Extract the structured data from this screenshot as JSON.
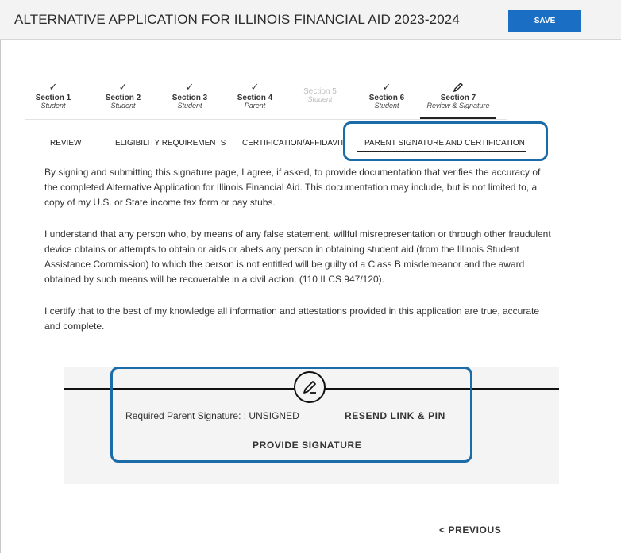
{
  "header": {
    "title": "ALTERNATIVE APPLICATION FOR ILLINOIS FINANCIAL AID 2023-2024",
    "save_label": "SAVE"
  },
  "steps": [
    {
      "name": "Section 1",
      "sub": "Student",
      "check": "✓",
      "state": "complete"
    },
    {
      "name": "Section 2",
      "sub": "Student",
      "check": "✓",
      "state": "complete"
    },
    {
      "name": "Section 3",
      "sub": "Student",
      "check": "✓",
      "state": "complete"
    },
    {
      "name": "Section 4",
      "sub": "Parent",
      "check": "✓",
      "state": "complete"
    },
    {
      "name": "Section 5",
      "sub": "Student",
      "check": "",
      "state": "disabled"
    },
    {
      "name": "Section 6",
      "sub": "Student",
      "check": "✓",
      "state": "complete"
    },
    {
      "name": "Section 7",
      "sub": "Review & Signature",
      "check": "pencil-icon",
      "state": "active"
    }
  ],
  "tabs": [
    {
      "label": "REVIEW"
    },
    {
      "label": "ELIGIBILITY REQUIREMENTS"
    },
    {
      "label": "CERTIFICATION/AFFIDAVIT"
    },
    {
      "label": "PARENT SIGNATURE AND CERTIFICATION",
      "active": true
    }
  ],
  "body": {
    "p1": "By signing and submitting this signature page, I agree, if asked, to provide documentation that verifies the accuracy of the completed Alternative Application for Illinois Financial Aid.  This documentation may include, but is not limited to, a copy of my U.S. or State income tax form or pay stubs.",
    "p2": "I understand that any person who, by means of any false statement, willful misrepresentation or through other fraudulent device obtains or attempts to obtain or aids or abets any person in obtaining student aid (from the Illinois Student Assistance Commission) to which the person is not entitled will be guilty of a Class B misdemeanor and the award obtained by such means will be recoverable in a civil action. (110 ILCS 947/120).",
    "p3": "I certify that to the best of my knowledge all information and attestations provided in this application are true, accurate and complete."
  },
  "signature": {
    "required_label": "Required Parent Signature: : UNSIGNED",
    "resend_label": "RESEND LINK & PIN",
    "provide_label": "PROVIDE SIGNATURE"
  },
  "nav": {
    "previous_label": "< PREVIOUS"
  },
  "colors": {
    "accent": "#1a6fc4",
    "highlight": "#1a6ba8"
  }
}
